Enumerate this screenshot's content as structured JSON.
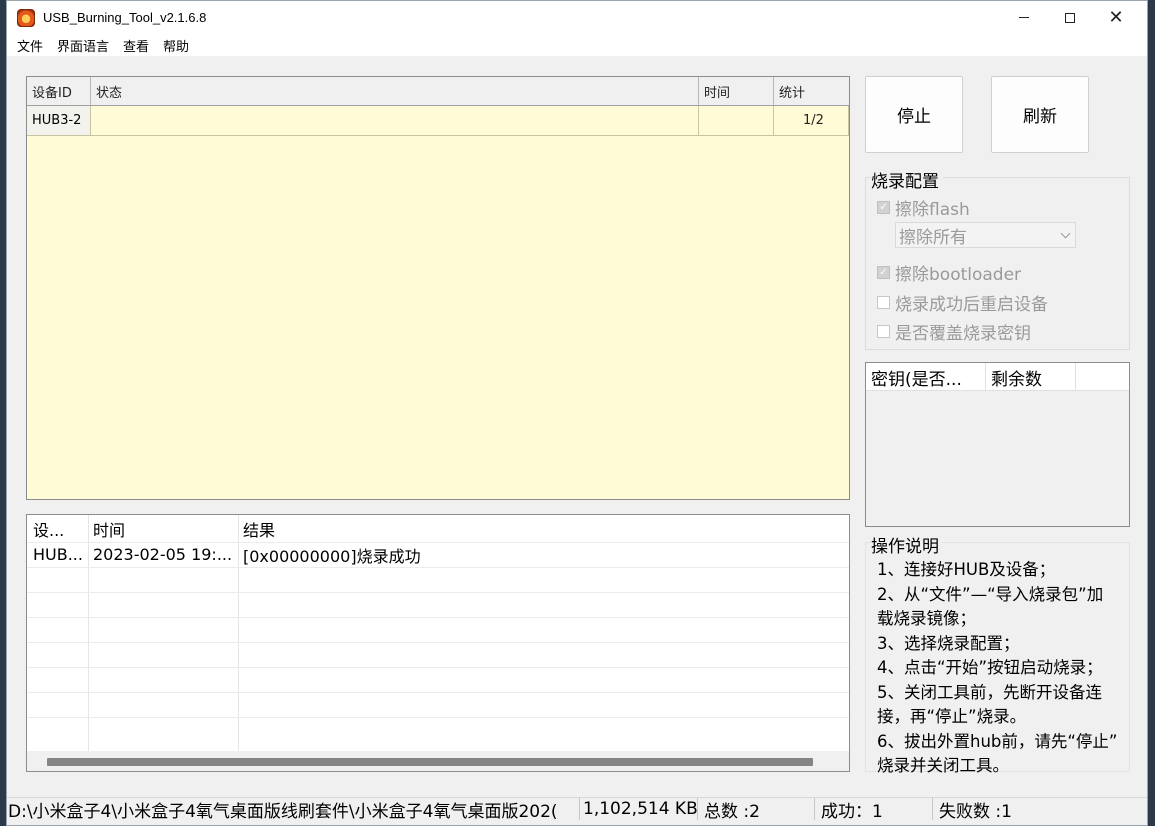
{
  "window": {
    "title": "USB_Burning_Tool_v2.1.6.8"
  },
  "menu": {
    "items": [
      "文件",
      "界面语言",
      "查看",
      "帮助"
    ]
  },
  "device_table": {
    "headers": [
      "设备ID",
      "状态",
      "时间",
      "统计"
    ],
    "rows": [
      {
        "id": "HUB3-2",
        "status": "",
        "time": "",
        "count": "1/2"
      }
    ]
  },
  "log_table": {
    "headers": [
      "设...",
      "时间",
      "结果"
    ],
    "rows": [
      {
        "device": "HUB...",
        "time": "2023-02-05 19:...",
        "result": "[0x00000000]烧录成功"
      }
    ]
  },
  "buttons": {
    "stop": "停止",
    "refresh": "刷新"
  },
  "burn_config": {
    "title": "烧录配置",
    "erase_flash": {
      "label": "擦除flash",
      "checked": true,
      "enabled": false
    },
    "erase_mode": {
      "value": "擦除所有"
    },
    "erase_bootloader": {
      "label": "擦除bootloader",
      "checked": true,
      "enabled": false
    },
    "reboot_after": {
      "label": "烧录成功后重启设备",
      "checked": false,
      "enabled": false
    },
    "overwrite_key": {
      "label": "是否覆盖烧录密钥",
      "checked": false,
      "enabled": false
    }
  },
  "key_table": {
    "headers": [
      "密钥(是否...",
      "剩余数"
    ]
  },
  "instructions": {
    "title": "操作说明",
    "lines": [
      "1、连接好HUB及设备；",
      "2、从“文件”—“导入烧录包”加",
      "载烧录镜像；",
      "3、选择烧录配置；",
      "4、点击“开始”按钮启动烧录；",
      "5、关闭工具前，先断开设备连",
      "接，再“停止”烧录。",
      "6、拔出外置hub前，请先“停止”",
      "烧录并关闭工具。"
    ]
  },
  "status_bar": {
    "path": "D:\\小米盒子4\\小米盒子4氧气桌面版线刷套件\\小米盒子4氧气桌面版202(",
    "size": "1,102,514 KB",
    "total": "总数 :2",
    "success": "成功：1",
    "fail": "失败数 :1"
  },
  "icons": {
    "app": "app-icon",
    "minimize": "minimize-icon",
    "maximize": "maximize-icon",
    "close": "close-icon"
  }
}
